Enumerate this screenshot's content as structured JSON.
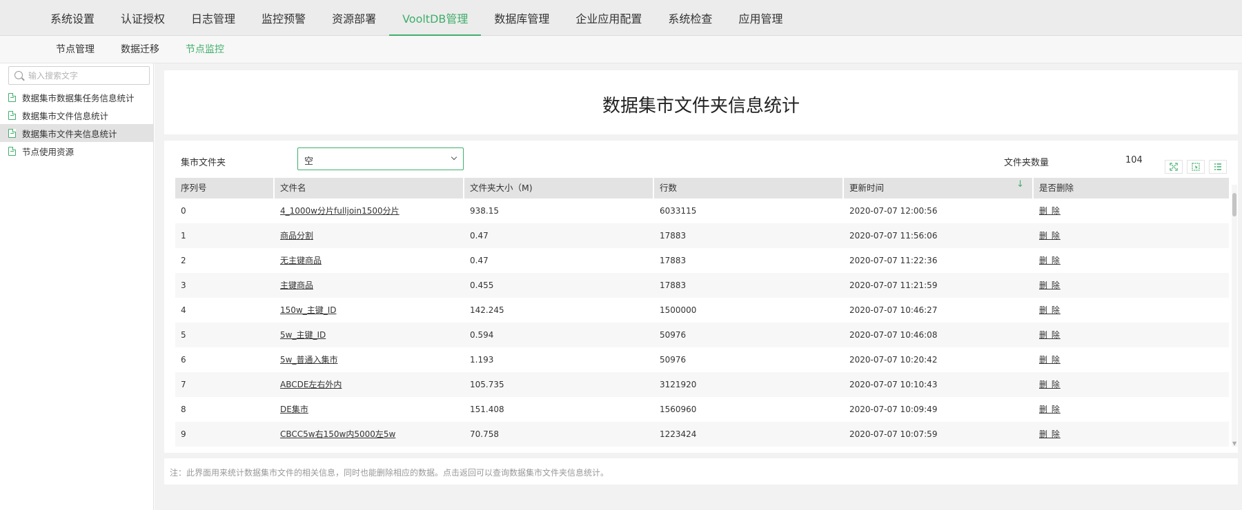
{
  "topnav": {
    "items": [
      "系统设置",
      "认证授权",
      "日志管理",
      "监控预警",
      "资源部署",
      "VooltDB管理",
      "数据库管理",
      "企业应用配置",
      "系统检查",
      "应用管理"
    ],
    "active_index": 5
  },
  "subnav": {
    "items": [
      "节点管理",
      "数据迁移",
      "节点监控"
    ],
    "active_index": 2
  },
  "sidebar": {
    "search_placeholder": "输入搜索文字",
    "items": [
      "数据集市数据集任务信息统计",
      "数据集市文件信息统计",
      "数据集市文件夹信息统计",
      "节点使用资源"
    ],
    "selected_index": 2
  },
  "page": {
    "title": "数据集市文件夹信息统计"
  },
  "filter": {
    "label": "集市文件夹",
    "selected_value": "空",
    "count_label": "文件夹数量",
    "count_value": "104"
  },
  "table": {
    "columns": [
      "序列号",
      "文件名",
      "文件夹大小（M)",
      "行数",
      "更新时间",
      "是否删除"
    ],
    "sort_column_index": 4,
    "sort_direction": "desc",
    "rows": [
      {
        "index": "0",
        "name": "4_1000w分片fulljoin1500分片",
        "size": "938.15",
        "lines": "6033115",
        "updated": "2020-07-07 12:00:56",
        "action": "删 除"
      },
      {
        "index": "1",
        "name": "商品分割",
        "size": "0.47",
        "lines": "17883",
        "updated": "2020-07-07 11:56:06",
        "action": "删 除"
      },
      {
        "index": "2",
        "name": "无主键商品",
        "size": "0.47",
        "lines": "17883",
        "updated": "2020-07-07 11:22:36",
        "action": "删 除"
      },
      {
        "index": "3",
        "name": "主键商品",
        "size": "0.455",
        "lines": "17883",
        "updated": "2020-07-07 11:21:59",
        "action": "删 除"
      },
      {
        "index": "4",
        "name": "150w_主键_ID",
        "size": "142.245",
        "lines": "1500000",
        "updated": "2020-07-07 10:46:27",
        "action": "删 除"
      },
      {
        "index": "5",
        "name": "5w_主键_ID",
        "size": "0.594",
        "lines": "50976",
        "updated": "2020-07-07 10:46:08",
        "action": "删 除"
      },
      {
        "index": "6",
        "name": "5w_普通入集市",
        "size": "1.193",
        "lines": "50976",
        "updated": "2020-07-07 10:20:42",
        "action": "删 除"
      },
      {
        "index": "7",
        "name": "ABCDE左右外内",
        "size": "105.735",
        "lines": "3121920",
        "updated": "2020-07-07 10:10:43",
        "action": "删 除"
      },
      {
        "index": "8",
        "name": "DE集市",
        "size": "151.408",
        "lines": "1560960",
        "updated": "2020-07-07 10:09:49",
        "action": "删 除"
      },
      {
        "index": "9",
        "name": "CBCC5w右150w内5000左5w",
        "size": "70.758",
        "lines": "1223424",
        "updated": "2020-07-07 10:07:59",
        "action": "删 除"
      }
    ]
  },
  "toolbar": {
    "icons": [
      "fullscreen-icon",
      "column-select-icon",
      "list-view-icon"
    ]
  },
  "note": {
    "text": "注：此界面用来统计数据集市文件的相关信息，同时也能删除相应的数据。点击返回可以查询数据集市文件夹信息统计。"
  },
  "colors": {
    "accent": "#3fae6a",
    "nav_bg": "#ececec",
    "header_bg": "#e3e3e3"
  }
}
